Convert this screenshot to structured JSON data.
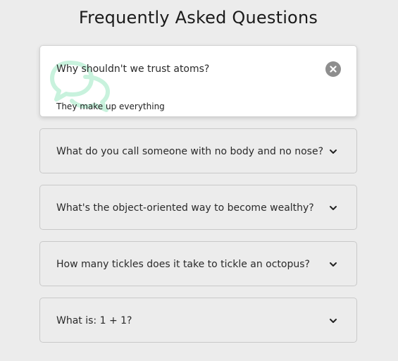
{
  "page": {
    "title": "Frequently Asked Questions"
  },
  "faqs": [
    {
      "question": "Why shouldn't we trust atoms?",
      "answer": "They make up everything",
      "expanded": true
    },
    {
      "question": "What do you call someone with no body and no nose?",
      "expanded": false
    },
    {
      "question": "What's the object-oriented way to become wealthy?",
      "expanded": false
    },
    {
      "question": "How many tickles does it take to tickle an octopus?",
      "expanded": false
    },
    {
      "question": "What is: 1 + 1?",
      "expanded": false
    }
  ],
  "icons": {
    "close": "close-icon",
    "expand": "chevron-down-icon",
    "decoration": "chat-bubbles-icon"
  },
  "colors": {
    "background": "#ececec",
    "card_active": "#ffffff",
    "close_button": "#8e8e8e",
    "decoration": "#c8f2dd"
  }
}
